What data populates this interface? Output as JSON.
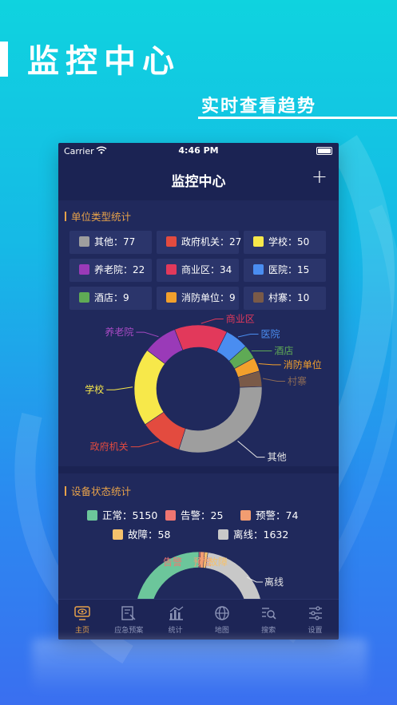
{
  "promo": {
    "title": "监控中心",
    "subtitle": "实时查看趋势"
  },
  "status_bar": {
    "carrier": "Carrier",
    "time": "4:46 PM"
  },
  "nav": {
    "title": "监控中心",
    "add_icon": "plus-icon"
  },
  "unit_section": {
    "title": "单位类型统计",
    "chips": [
      {
        "label": "其他：77",
        "color": "#9e9e9e"
      },
      {
        "label": "政府机关：27",
        "color": "#e34b3f"
      },
      {
        "label": "学校：50",
        "color": "#f7e84a"
      },
      {
        "label": "养老院：22",
        "color": "#9a3ab8"
      },
      {
        "label": "商业区：34",
        "color": "#e2395b"
      },
      {
        "label": "医院：15",
        "color": "#4a8df0"
      },
      {
        "label": "酒店：9",
        "color": "#5faa55"
      },
      {
        "label": "消防单位：9",
        "color": "#f2a02c"
      },
      {
        "label": "村寨：10",
        "color": "#7a5a48"
      }
    ]
  },
  "chart_data": [
    {
      "type": "pie",
      "categories": [
        "其他",
        "政府机关",
        "学校",
        "养老院",
        "商业区",
        "医院",
        "酒店",
        "消防单位",
        "村寨"
      ],
      "values": [
        77,
        27,
        50,
        22,
        34,
        15,
        9,
        9,
        10
      ],
      "colors": [
        "#9e9e9e",
        "#e34b3f",
        "#f7e84a",
        "#9a3ab8",
        "#e2395b",
        "#4a8df0",
        "#5faa55",
        "#f2a02c",
        "#7a5a48"
      ],
      "label_colors": [
        "#e6e6e6",
        "#e34b3f",
        "#f7e84a",
        "#a84ac4",
        "#e2395b",
        "#4a8df0",
        "#5faa55",
        "#f2a02c",
        "#8b6a56"
      ]
    },
    {
      "type": "pie",
      "categories": [
        "正常",
        "告警",
        "预警",
        "故障",
        "离线"
      ],
      "values": [
        5150,
        25,
        74,
        58,
        1632
      ],
      "colors": [
        "#6cc69b",
        "#ef7571",
        "#f29d71",
        "#f6c26c",
        "#c8c8c8"
      ],
      "visible_labels": [
        "告警",
        "预警",
        "故障",
        "离线"
      ]
    }
  ],
  "device_section": {
    "title": "设备状态统计",
    "legend": [
      {
        "label": "正常：5150",
        "color": "#6cc69b"
      },
      {
        "label": "告警：25",
        "color": "#ef7571"
      },
      {
        "label": "预警：74",
        "color": "#f29d71"
      },
      {
        "label": "故障：58",
        "color": "#f6c26c"
      },
      {
        "label": "离线：1632",
        "color": "#c8c8c8"
      }
    ]
  },
  "tabbar": {
    "items": [
      {
        "label": "主页",
        "icon": "eye-monitor-icon",
        "active": true
      },
      {
        "label": "应急预案",
        "icon": "plan-document-icon",
        "active": false
      },
      {
        "label": "统计",
        "icon": "bar-chart-icon",
        "active": false
      },
      {
        "label": "地图",
        "icon": "globe-icon",
        "active": false
      },
      {
        "label": "搜索",
        "icon": "search-list-icon",
        "active": false
      },
      {
        "label": "设置",
        "icon": "sliders-icon",
        "active": false
      }
    ]
  }
}
